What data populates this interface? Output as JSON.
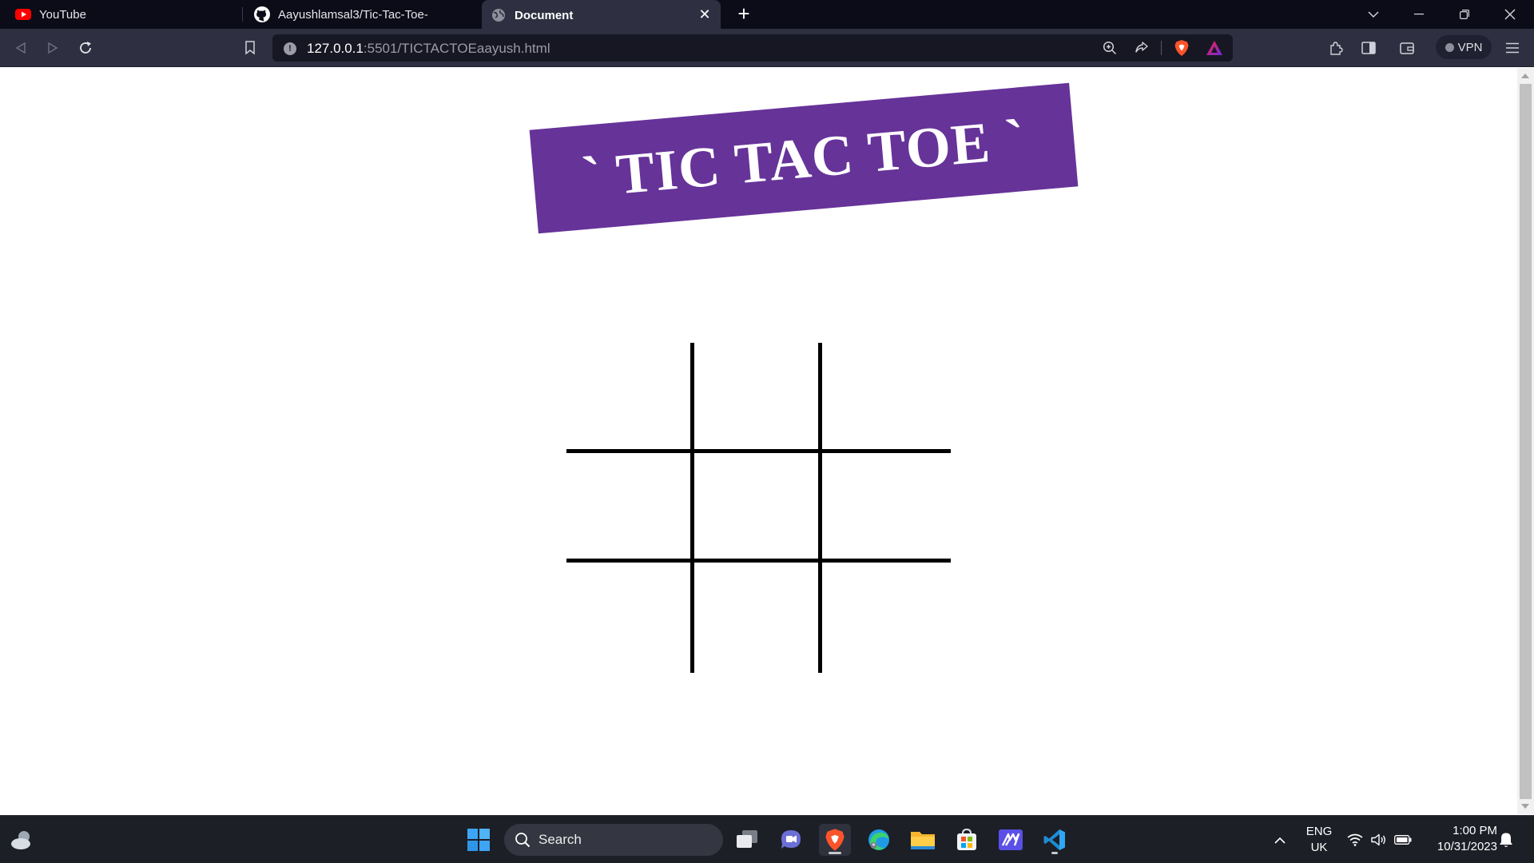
{
  "browser": {
    "tabs": [
      {
        "title": "YouTube",
        "favicon": "youtube-icon",
        "active": false
      },
      {
        "title": "Aayushlamsal3/Tic-Tac-Toe-",
        "favicon": "github-icon",
        "active": false
      },
      {
        "title": "Document",
        "favicon": "globe-icon",
        "active": true
      }
    ],
    "address": {
      "host": "127.0.0.1",
      "path": ":5501/TICTACTOEaayush.html",
      "info_symbol": "!"
    },
    "vpn_label": "VPN"
  },
  "page": {
    "banner_text": "` TIC TAC TOE `",
    "banner_color": "#663399",
    "board": {
      "rows": 3,
      "columns": 3,
      "line_color": "#000000"
    }
  },
  "taskbar": {
    "search_label": "Search",
    "language": "ENG",
    "region": "UK",
    "time": "1:00 PM",
    "date": "10/31/2023"
  },
  "colors": {
    "tabstrip_bg": "#0b0c18",
    "toolbar_bg": "#2e3041",
    "taskbar_bg": "#1c1f26",
    "brave_orange": "#fb542b",
    "youtube_red": "#ff0000"
  }
}
